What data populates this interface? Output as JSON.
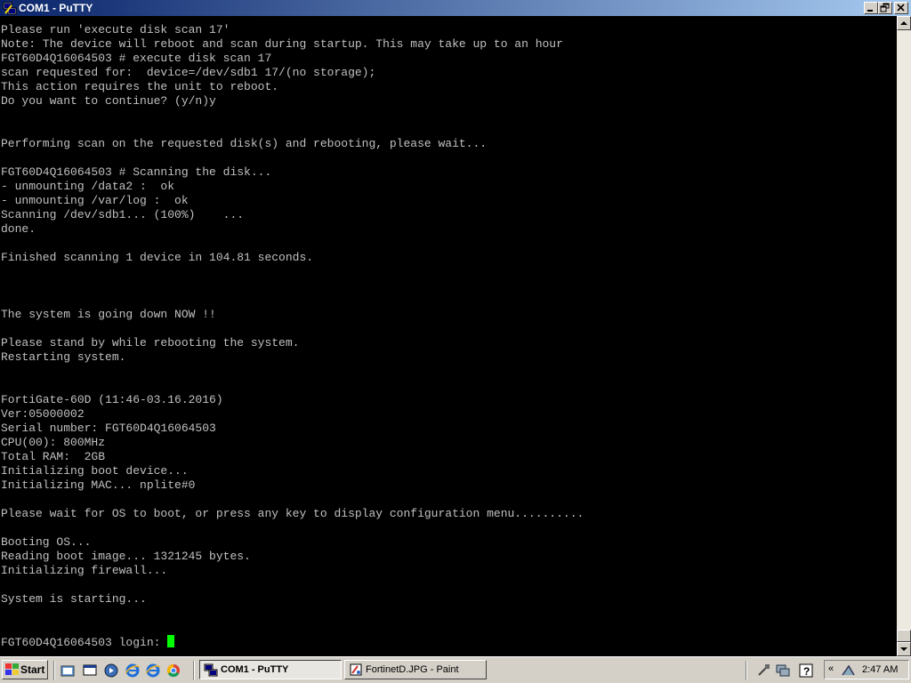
{
  "window": {
    "title": "COM1 - PuTTY",
    "icon": "putty-icon"
  },
  "terminal": {
    "lines": [
      "Please run 'execute disk scan 17'",
      "Note: The device will reboot and scan during startup. This may take up to an hour",
      "FGT60D4Q16064503 # execute disk scan 17",
      "scan requested for:  device=/dev/sdb1 17/(no storage);",
      "This action requires the unit to reboot.",
      "Do you want to continue? (y/n)y",
      "",
      "",
      "Performing scan on the requested disk(s) and rebooting, please wait...",
      "",
      "FGT60D4Q16064503 # Scanning the disk...",
      "- unmounting /data2 :  ok",
      "- unmounting /var/log :  ok",
      "Scanning /dev/sdb1... (100%)    ...",
      "done.",
      "",
      "Finished scanning 1 device in 104.81 seconds.",
      "",
      "",
      "",
      "The system is going down NOW !!",
      "",
      "Please stand by while rebooting the system.",
      "Restarting system.",
      "",
      "",
      "FortiGate-60D (11:46-03.16.2016)",
      "Ver:05000002",
      "Serial number: FGT60D4Q16064503",
      "CPU(00): 800MHz",
      "Total RAM:  2GB",
      "Initializing boot device...",
      "Initializing MAC... nplite#0",
      "",
      "Please wait for OS to boot, or press any key to display configuration menu..........",
      "",
      "Booting OS...",
      "Reading boot image... 1321245 bytes.",
      "Initializing firewall...",
      "",
      "System is starting...",
      "",
      "",
      "FGT60D4Q16064503 login: "
    ],
    "text_color": "#c0c0c0",
    "background": "#000000",
    "cursor_color": "#00ff00"
  },
  "taskbar": {
    "start_label": "Start",
    "tasks": [
      {
        "label": "COM1 - PuTTY",
        "icon": "putty-icon",
        "active": true
      },
      {
        "label": "FortinetD.JPG - Paint",
        "icon": "paint-icon",
        "active": false
      }
    ],
    "clock": "2:47 AM"
  }
}
